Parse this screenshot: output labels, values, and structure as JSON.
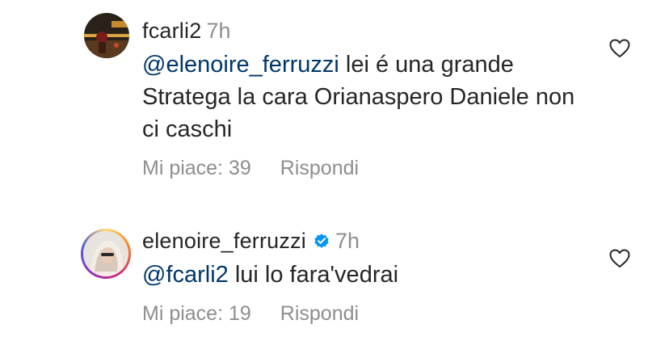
{
  "comments": [
    {
      "username": "fcarli2",
      "time": "7h",
      "mention": "@elenoire_ferruzzi",
      "text": " lei é una grande Stratega la cara Orianaspero Daniele non ci caschi",
      "likes_label": "Mi piace: 39",
      "reply_label": "Rispondi",
      "verified": false
    },
    {
      "username": "elenoire_ferruzzi",
      "time": "7h",
      "mention": "@fcarli2",
      "text": " lui lo fara'vedrai",
      "likes_label": "Mi piace: 19",
      "reply_label": "Rispondi",
      "verified": true
    }
  ],
  "colors": {
    "text": "#262626",
    "secondary": "#8e8e8e",
    "mention": "#00376b",
    "verified": "#0095f6"
  },
  "icons": {
    "like": "heart-outline-icon",
    "verified": "verified-badge-icon"
  }
}
